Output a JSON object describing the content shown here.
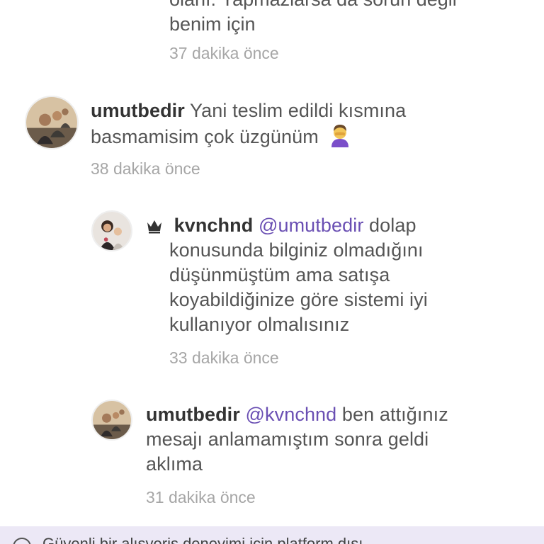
{
  "comments": [
    {
      "lines": [
        "olanı. Yapmazlarsa da sorun değil",
        "benim için"
      ],
      "time": "37 dakika önce"
    },
    {
      "username": "umutbedir",
      "text_line1": "Yani teslim edildi kısmına",
      "text_line2": "basmamisim çok üzgünüm",
      "emoji": "facepalm-emoji",
      "time": "38 dakika önce"
    },
    {
      "username": "kvnchnd",
      "badge": "crown-icon",
      "mention": "@umutbedir",
      "text_line1": "dolap",
      "text_line2": "konusunda bilginiz olmadığını",
      "text_line3": "düşünmüştüm ama satışa",
      "text_line4": "koyabildiğinize göre sistemi iyi",
      "text_line5": "kullanıyor olmalısınız",
      "time": "33 dakika önce"
    },
    {
      "username": "umutbedir",
      "mention": "@kvnchnd",
      "text_line1": "ben attığınız",
      "text_line2": "mesajı anlamamıştım sonra geldi",
      "text_line3": "aklıma",
      "time": "31 dakika önce"
    }
  ],
  "banner": {
    "icon": "info-icon",
    "text": "Güvenli bir alışveriş deneyimi için platform dışı"
  },
  "colors": {
    "mention": "#6a4fb3",
    "timestamp": "#a6a6a6",
    "banner_bg": "#ece8f6"
  }
}
